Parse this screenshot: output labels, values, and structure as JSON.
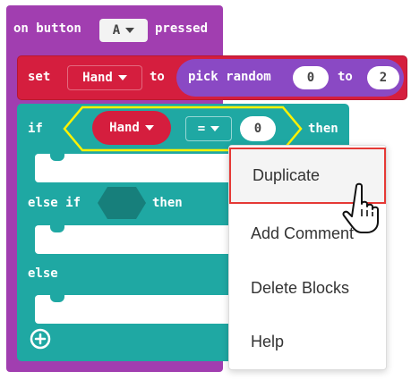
{
  "event_block": {
    "prefix": "on button",
    "button_value": "A",
    "suffix": "pressed",
    "color": "#a13eb0"
  },
  "set_block": {
    "keyword": "set",
    "variable": "Hand",
    "to": "to",
    "random_label": "pick random",
    "from_value": "0",
    "to_label": "to",
    "to_value": "2",
    "color": "#d51e3e"
  },
  "if_block": {
    "if_label": "if",
    "condition_variable": "Hand",
    "operator": "=",
    "compare_value": "0",
    "then_label": "then",
    "else_if_label": "else if",
    "else_if_then": "then",
    "else_label": "else",
    "color": "#1fa8a3"
  },
  "context_menu": {
    "items": [
      "Duplicate",
      "Add Comment",
      "Delete Blocks",
      "Help"
    ],
    "highlight_color": "#e53935"
  },
  "icons": {
    "add": "plus-circle-icon",
    "cursor": "hand-pointer-icon"
  }
}
